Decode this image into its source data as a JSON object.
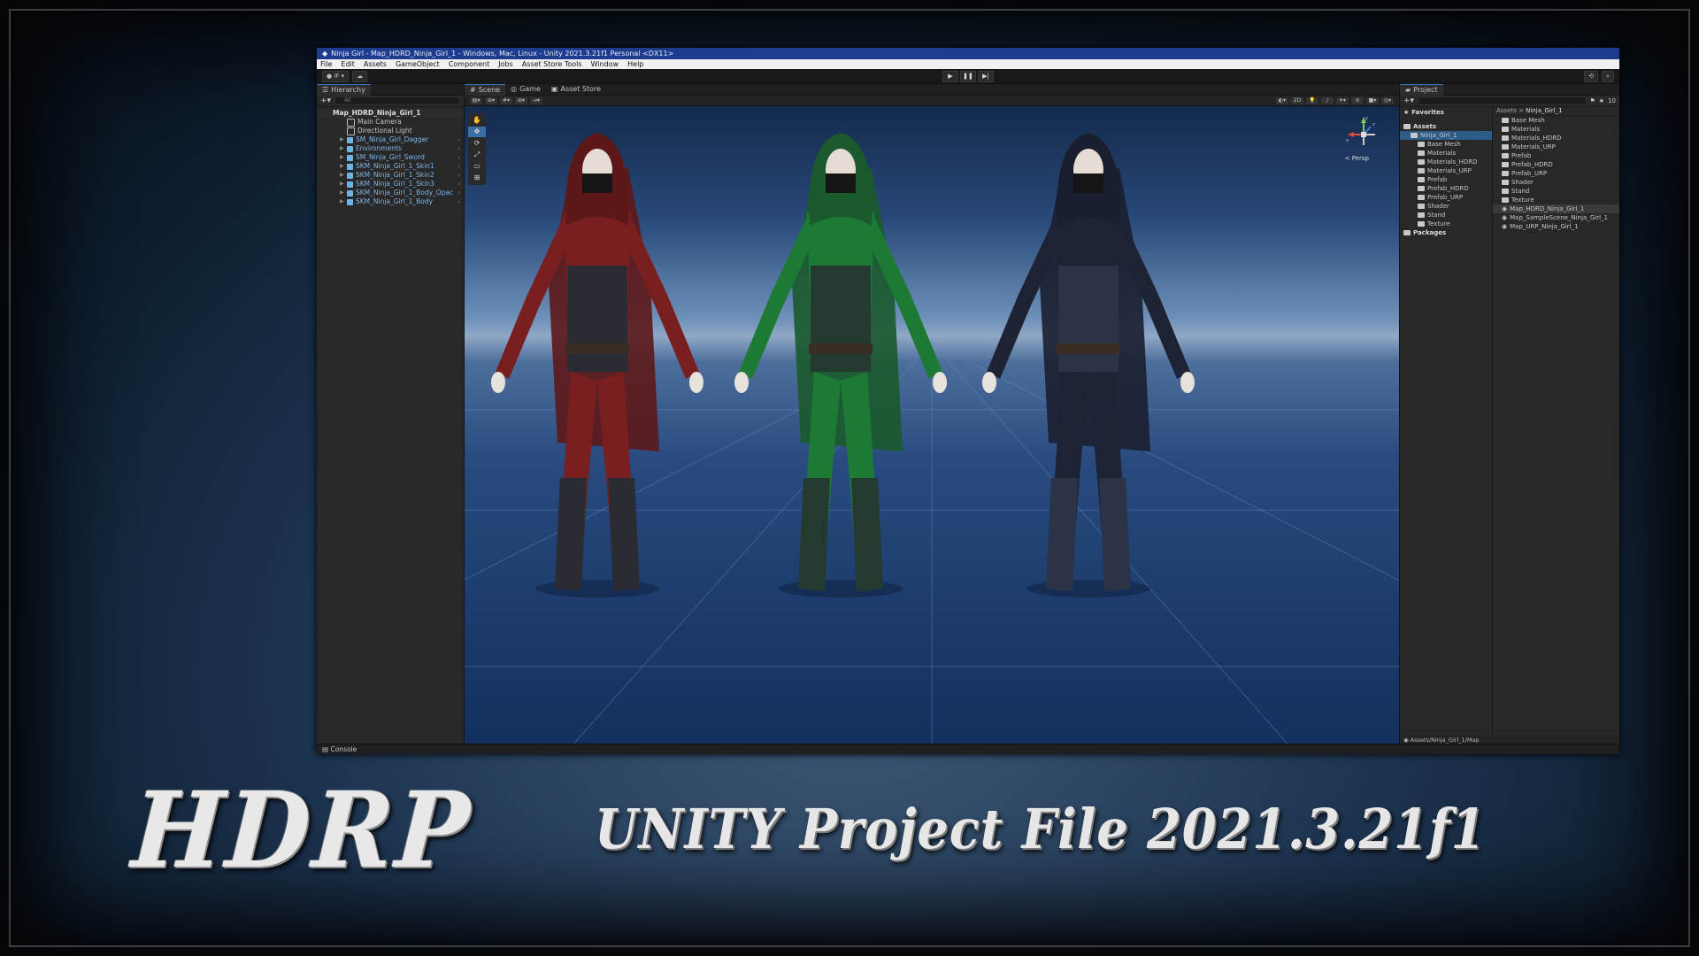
{
  "banner": {
    "left_title": "HDRP",
    "subtitle": "UNITY Project File  2021.3.21f1"
  },
  "window": {
    "title": "Ninja Girl - Map_HDRD_Ninja_Girl_1 - Windows, Mac, Linux - Unity 2021.3.21f1 Personal <DX11>"
  },
  "menu": [
    "File",
    "Edit",
    "Assets",
    "GameObject",
    "Component",
    "Jobs",
    "Asset Store Tools",
    "Window",
    "Help"
  ],
  "toolbar": {
    "account_label": "IF"
  },
  "hierarchy": {
    "tab": "Hierarchy",
    "search_placeholder": "All",
    "scene": "Map_HDRD_Ninja_Girl_1",
    "items": [
      {
        "label": "Main Camera",
        "kind": "object",
        "children": false
      },
      {
        "label": "Directional Light",
        "kind": "object",
        "children": false
      },
      {
        "label": "SM_Ninja_Girl_Dagger",
        "kind": "prefab",
        "children": true
      },
      {
        "label": "Environments",
        "kind": "prefab",
        "children": true
      },
      {
        "label": "SM_Ninja_Girl_Sword",
        "kind": "prefab",
        "children": true
      },
      {
        "label": "SKM_Ninja_Girl_1_Skin1",
        "kind": "prefab",
        "children": true
      },
      {
        "label": "SKM_Ninja_Girl_1_Skin2",
        "kind": "prefab",
        "children": true
      },
      {
        "label": "SKM_Ninja_Girl_1_Skin3",
        "kind": "prefab",
        "children": true
      },
      {
        "label": "SKM_Ninja_Girl_1_Body_Opac",
        "kind": "prefab",
        "children": true
      },
      {
        "label": "SKM_Ninja_Girl_1_Body",
        "kind": "prefab",
        "children": true
      }
    ]
  },
  "scene_view": {
    "tabs": [
      "Scene",
      "Game",
      "Asset Store"
    ],
    "mode_2d": "2D",
    "persp_label": "< Persp",
    "gizmo_axes": [
      "y",
      "x",
      "z"
    ],
    "skins": [
      {
        "name": "red",
        "primary": "#7a1f1f",
        "secondary": "#2b2b33",
        "hood": "#5c1818"
      },
      {
        "name": "green",
        "primary": "#1d7a35",
        "secondary": "#253a2e",
        "hood": "#1a5a2c"
      },
      {
        "name": "navy",
        "primary": "#1e2333",
        "secondary": "#2b3347",
        "hood": "#1a1f30"
      }
    ]
  },
  "project": {
    "tab": "Project",
    "favorites": "Favorites",
    "assets_root": "Assets",
    "packages": "Packages",
    "tree": [
      {
        "label": "Ninja_Girl_1",
        "depth": 1,
        "selected": true
      },
      {
        "label": "Base Mesh",
        "depth": 2
      },
      {
        "label": "Materials",
        "depth": 2
      },
      {
        "label": "Materials_HDRD",
        "depth": 2
      },
      {
        "label": "Materials_URP",
        "depth": 2
      },
      {
        "label": "Prefab",
        "depth": 2
      },
      {
        "label": "Prefab_HDRD",
        "depth": 2
      },
      {
        "label": "Prefab_URP",
        "depth": 2
      },
      {
        "label": "Shader",
        "depth": 2
      },
      {
        "label": "Stand",
        "depth": 2
      },
      {
        "label": "Texture",
        "depth": 2
      }
    ],
    "breadcrumb": {
      "root": "Assets",
      "sep": ">",
      "current": "Ninja_Girl_1"
    },
    "list": [
      {
        "label": "Base Mesh",
        "type": "folder"
      },
      {
        "label": "Materials",
        "type": "folder"
      },
      {
        "label": "Materials_HDRD",
        "type": "folder"
      },
      {
        "label": "Materials_URP",
        "type": "folder"
      },
      {
        "label": "Prefab",
        "type": "folder"
      },
      {
        "label": "Prefab_HDRD",
        "type": "folder"
      },
      {
        "label": "Prefab_URP",
        "type": "folder"
      },
      {
        "label": "Shader",
        "type": "folder"
      },
      {
        "label": "Stand",
        "type": "folder"
      },
      {
        "label": "Texture",
        "type": "folder"
      },
      {
        "label": "Map_HDRD_Ninja_Girl_1",
        "type": "scene",
        "selected": true
      },
      {
        "label": "Map_SampleScene_Ninja_Girl_1",
        "type": "scene"
      },
      {
        "label": "Map_URP_Ninja_Girl_1",
        "type": "scene"
      }
    ],
    "hidden_count": "10",
    "status_path": "Assets/Ninja_Girl_1/Map"
  },
  "console": {
    "tab": "Console"
  }
}
